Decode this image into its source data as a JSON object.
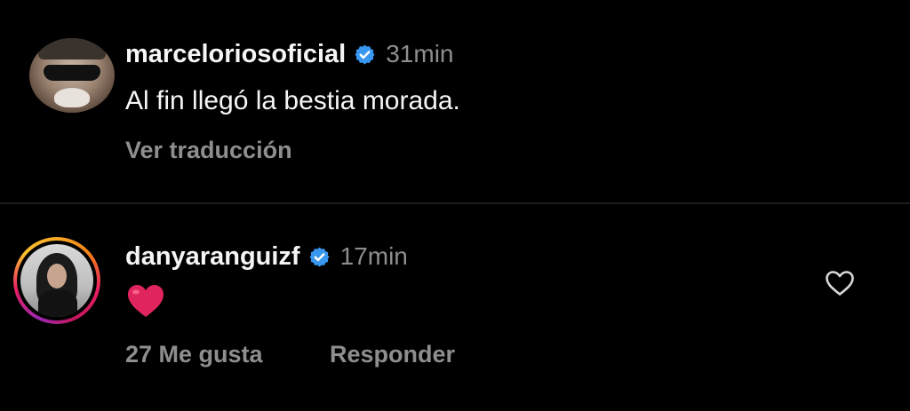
{
  "comments": [
    {
      "username": "marceloriosoficial",
      "verified": true,
      "time": "31min",
      "text": "Al fin llegó la bestia morada.",
      "translate_label": "Ver traducción"
    },
    {
      "username": "danyaranguizf",
      "verified": true,
      "time": "17min",
      "text": "❤️",
      "likes_label": "27 Me gusta",
      "reply_label": "Responder"
    }
  ],
  "icons": {
    "verified": "verified-badge-icon",
    "like": "heart-outline-icon",
    "emoji": "red-heart-emoji"
  },
  "colors": {
    "background": "#000000",
    "primary_text": "#f5f5f5",
    "secondary_text": "#8e8e8e",
    "verified_blue": "#3897f0",
    "emoji_red": "#e0245e"
  }
}
